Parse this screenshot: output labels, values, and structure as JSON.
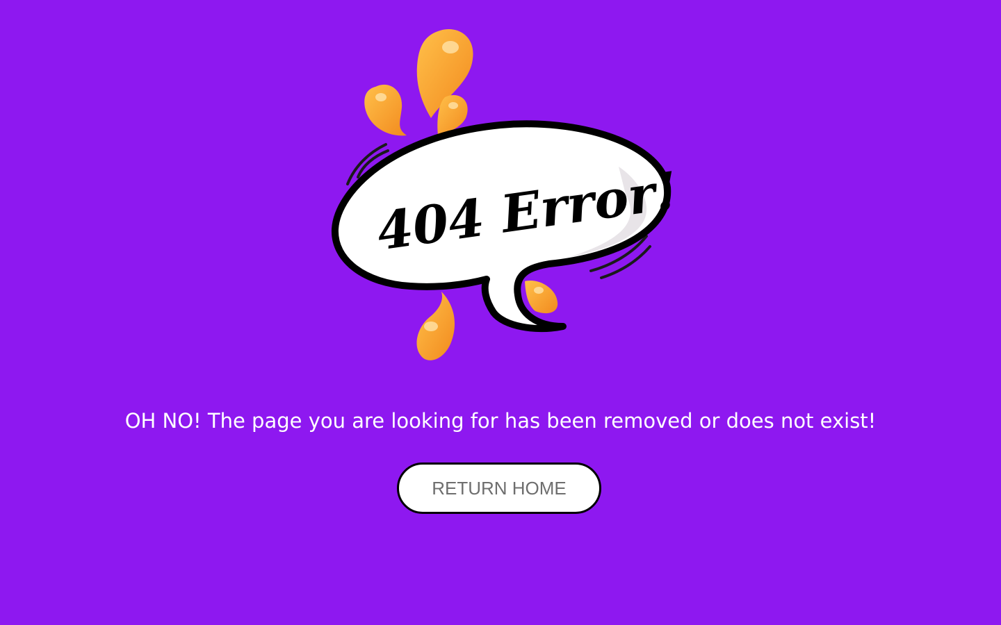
{
  "illustration": {
    "bubble_text": "404 Error!",
    "splash_color": "#f7a030",
    "bubble_outline_color": "#000000",
    "bubble_fill_color": "#ffffff"
  },
  "message": "OH NO! The page you are looking for has been removed or does not exist!",
  "button": {
    "label": "RETURN HOME"
  },
  "colors": {
    "background": "#8e18f0",
    "text": "#ffffff",
    "button_text": "#6e6e6e"
  }
}
